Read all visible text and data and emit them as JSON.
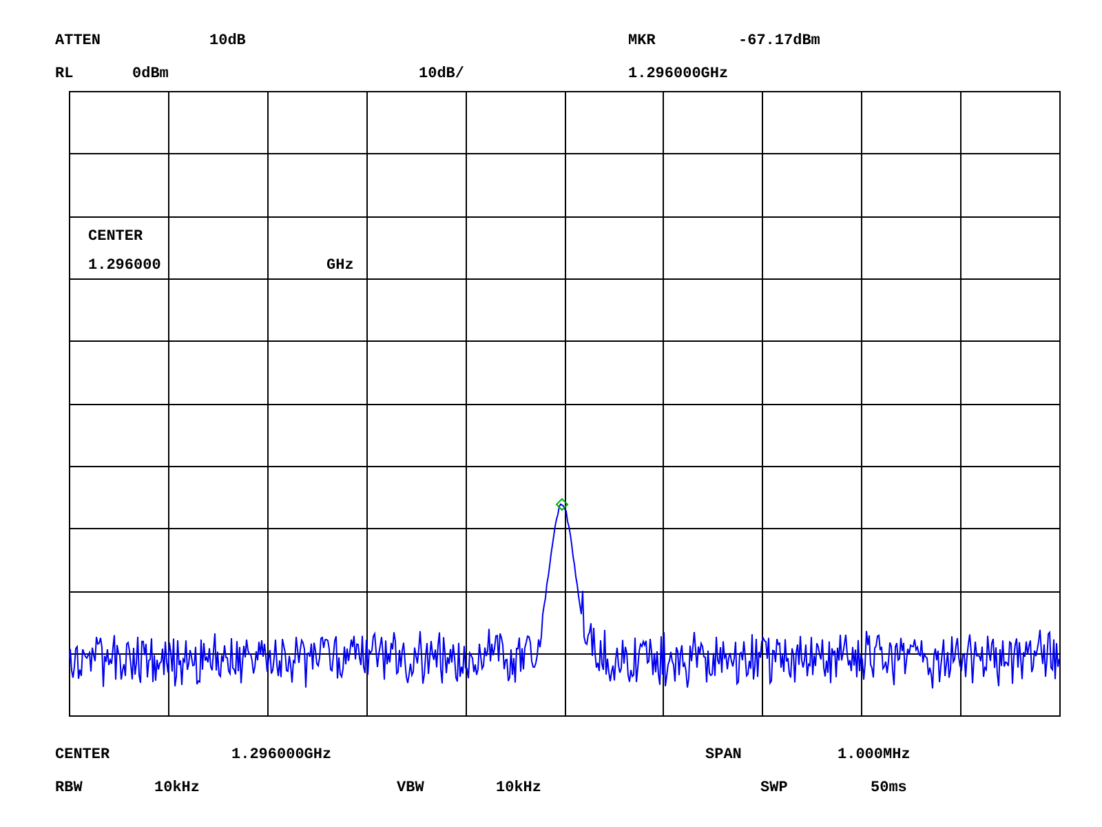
{
  "top_lines": [
    [
      {
        "text": "ATTEN"
      },
      {
        "text": "10dB"
      },
      {
        "text": "MKR"
      },
      {
        "text": "-67.17dBm"
      }
    ],
    [
      {
        "text": "RL"
      },
      {
        "text": "0dBm"
      },
      {
        "text": "10dB/"
      },
      {
        "text": "1.296000GHz"
      }
    ]
  ],
  "center_overlay": {
    "label": "CENTER",
    "value": "1.296000",
    "unit": "GHz"
  },
  "bottom_lines": [
    [
      {
        "text": "CENTER"
      },
      {
        "text": "1.296000GHz"
      },
      {
        "text": "SPAN"
      },
      {
        "text": "1.000MHz"
      }
    ],
    [
      {
        "text": "RBW"
      },
      {
        "text": "10kHz"
      },
      {
        "text": "VBW"
      },
      {
        "text": "10kHz"
      },
      {
        "text": "SWP"
      },
      {
        "text": "50ms"
      }
    ]
  ]
}
